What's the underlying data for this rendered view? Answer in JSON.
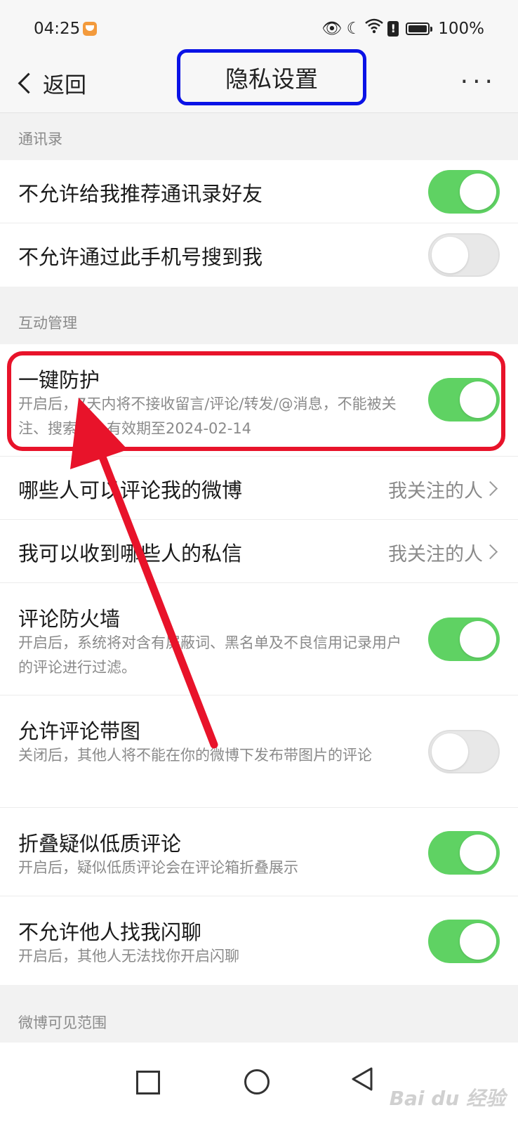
{
  "status_bar": {
    "time": "04:25",
    "battery": "100%"
  },
  "header": {
    "back_label": "返回",
    "title": "隐私设置",
    "more": "···"
  },
  "sections": {
    "contacts": "通讯录",
    "interaction": "互动管理",
    "visibility": "微博可见范围"
  },
  "rows": {
    "no_recommend": {
      "title": "不允许给我推荐通讯录好友",
      "toggle": "on"
    },
    "no_phone_search": {
      "title": "不允许通过此手机号搜到我",
      "toggle": "off"
    },
    "one_key": {
      "title": "一键防护",
      "desc": "开启后，7天内将不接收留言/评论/转发/@消息，不能被关注、搜索到，有效期至2024-02-14",
      "toggle": "on"
    },
    "who_comment": {
      "title": "哪些人可以评论我的微博",
      "value": "我关注的人"
    },
    "who_message": {
      "title": "我可以收到哪些人的私信",
      "value": "我关注的人"
    },
    "firewall": {
      "title": "评论防火墙",
      "desc": "开启后，系统将对含有屏蔽词、黑名单及不良信用记录用户的评论进行过滤。",
      "toggle": "on"
    },
    "allow_image": {
      "title": "允许评论带图",
      "desc": "关闭后，其他人将不能在你的微博下发布带图片的评论",
      "toggle": "off"
    },
    "fold_low": {
      "title": "折叠疑似低质评论",
      "desc": "开启后，疑似低质评论会在评论箱折叠展示",
      "toggle": "on"
    },
    "no_flash": {
      "title": "不允许他人找我闪聊",
      "desc": "开启后，其他人无法找你开启闪聊",
      "toggle": "on"
    }
  },
  "icons": [
    "eye-icon",
    "moon-icon",
    "wifi-icon",
    "alert-icon",
    "battery-icon"
  ],
  "colors": {
    "toggle_on": "#5fd263",
    "highlight_red": "#e8132a",
    "highlight_blue": "#0a12e6"
  },
  "watermark": "Bai du 经验"
}
